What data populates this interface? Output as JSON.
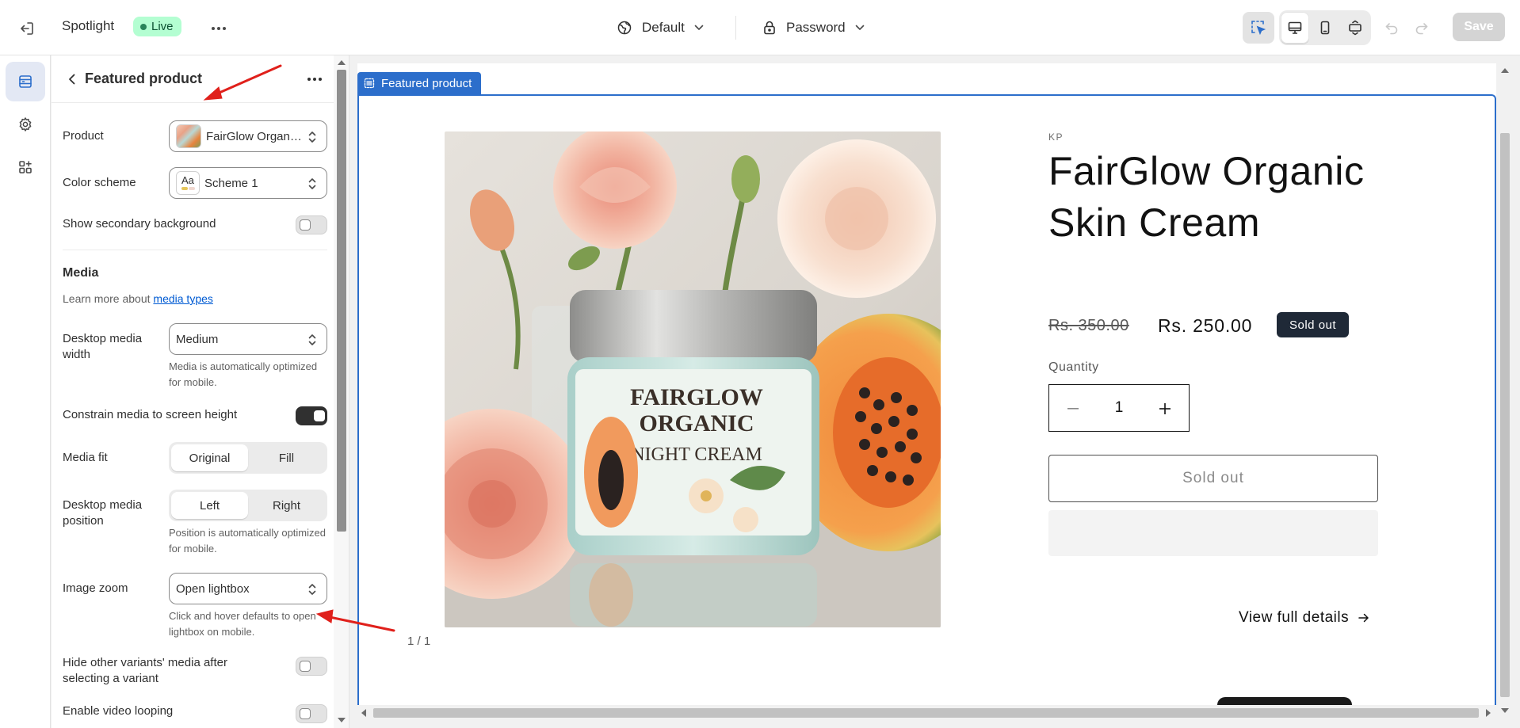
{
  "topbar": {
    "title": "Spotlight",
    "status": "Live",
    "theme_label": "Default",
    "password_label": "Password",
    "save_label": "Save"
  },
  "panel": {
    "title": "Featured product",
    "product": {
      "label": "Product",
      "value": "FairGlow Organic Skin Cream"
    },
    "color_scheme": {
      "label": "Color scheme",
      "value": "Scheme 1",
      "swatch_text": "Aa"
    },
    "secondary_bg": {
      "label": "Show secondary background",
      "on": false
    },
    "media": {
      "heading": "Media",
      "learn_prefix": "Learn more about ",
      "learn_link": "media types",
      "desktop_width": {
        "label": "Desktop media width",
        "value": "Medium",
        "help": "Media is automatically optimized for mobile."
      },
      "constrain": {
        "label": "Constrain media to screen height",
        "on": true
      },
      "fit": {
        "label": "Media fit",
        "options": [
          "Original",
          "Fill"
        ],
        "selected": "Original"
      },
      "position": {
        "label": "Desktop media position",
        "options": [
          "Left",
          "Right"
        ],
        "selected": "Left",
        "help": "Position is automatically optimized for mobile."
      },
      "zoom": {
        "label": "Image zoom",
        "value": "Open lightbox",
        "help": "Click and hover defaults to open lightbox on mobile."
      },
      "hide_variants": {
        "label": "Hide other variants' media after selecting a variant",
        "on": false
      },
      "video_loop": {
        "label": "Enable video looping",
        "on": false
      }
    }
  },
  "preview": {
    "section_tag": "Featured product",
    "vendor": "KP",
    "product_title": "FairGlow Organic Skin Cream",
    "price_compare": "Rs. 350.00",
    "price": "Rs. 250.00",
    "badge": "Sold out",
    "quantity_label": "Quantity",
    "quantity_value": "1",
    "button_sold_out": "Sold out",
    "view_details": "View full details",
    "pager": "1 / 1",
    "jar_label": {
      "line1": "FAIRGLOW",
      "line2": "ORGANIC",
      "line3": "NIGHT CREAM"
    }
  },
  "colors": {
    "accent_blue": "#2c6ecb",
    "live_badge_bg": "#b4fed2",
    "annotation_red": "#e0201b",
    "badge_dark": "#1f2937"
  }
}
